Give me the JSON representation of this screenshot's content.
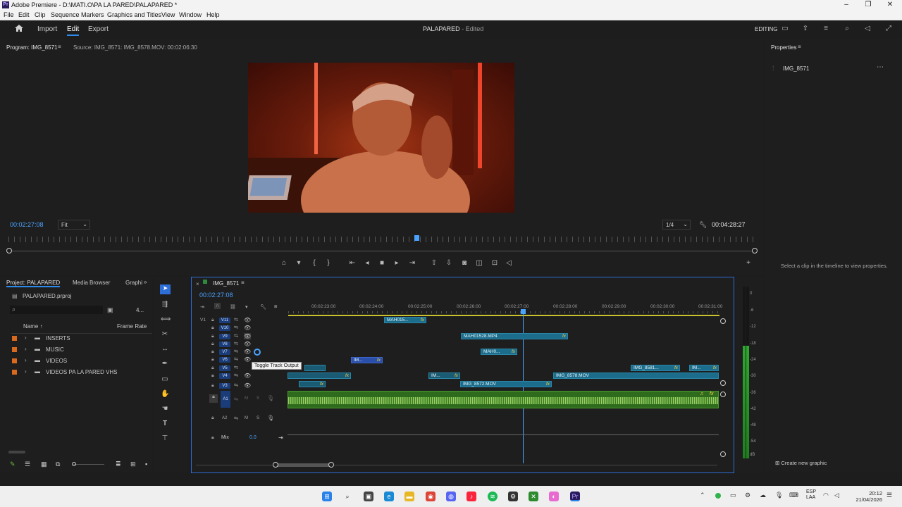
{
  "window": {
    "title": "Adobe Premiere - D:\\MATI.O\\PA LA PARED\\PALAPARED *",
    "minimize": "–",
    "maximize": "❐",
    "close": "✕"
  },
  "menu": [
    "File",
    "Edit",
    "Clip",
    "Sequence",
    "Markers",
    "Graphics and Titles",
    "View",
    "Window",
    "Help"
  ],
  "appbar": {
    "import": "Import",
    "edit": "Edit",
    "export": "Export",
    "project_title": "PALAPARED",
    "status": " - Edited",
    "workspace": "EDITING"
  },
  "monitor": {
    "program_tab": "Program: IMG_8571",
    "source_tab": "Source: IMG_8571: IMG_8578.MOV: 00:02:06:30",
    "timecode": "00:02:27:08",
    "fit": "Fit",
    "resolution": "1/4",
    "duration": "00:04:28:27"
  },
  "properties": {
    "tab": "Properties",
    "item": "IMG_8571",
    "hint": "Select a clip in the timeline to view properties.",
    "create_graphic": "Create new graphic"
  },
  "project": {
    "tabs": [
      "Project: PALAPARED",
      "Media Browser",
      "Graphi"
    ],
    "file": "PALAPARED.prproj",
    "count": "4...",
    "col_name": "Name",
    "col_rate": "Frame Rate",
    "bins": [
      "INSERTS",
      "MUSIC",
      "VIDEOS",
      "VIDEOS PA LA PARED VHS"
    ],
    "bin_color": "#d9691f"
  },
  "timeline": {
    "sequence": "IMG_8571",
    "timecode": "00:02:27:08",
    "ruler": [
      "00:02:23:00",
      "00:02:24:00",
      "00:02:25:00",
      "00:02:26:00",
      "00:02:27:00",
      "00:02:28:00",
      "00:02:29:00",
      "00:02:30:00",
      "00:02:31:00"
    ],
    "tracks_video": [
      "V11",
      "V10",
      "V9",
      "V8",
      "V7",
      "V6",
      "V5",
      "V4",
      "V3"
    ],
    "tracks_audio": [
      "A1",
      "A2"
    ],
    "source_patch": "V1",
    "mix_label": "Mix",
    "mix_value": "0.0",
    "tooltip": "Toggle Track Output",
    "m": "M",
    "s": "S",
    "clips": {
      "c1": "MAH015...",
      "c2": "MAH01528.MP4",
      "c3": "MAH0...",
      "c4": "IM...",
      "c5": "IMG_8581...",
      "c6": "IM...",
      "c7": "IM...",
      "c8": "IMG_8578.MOV",
      "c9": "IMG_8572.MOV",
      "fx": "fx"
    }
  },
  "meter": {
    "labels": [
      "0",
      "-6",
      "-12",
      "-18",
      "-24",
      "-30",
      "-36",
      "-42",
      "-48",
      "-54",
      "dB"
    ]
  },
  "taskbar": {
    "lang": "ESP\nLAA",
    "time": "20:12",
    "date": "21/04/2026"
  },
  "colors": {
    "accent": "#2d8ceb",
    "audio": "#3d8a2a",
    "clip": "#1c6d8c"
  }
}
